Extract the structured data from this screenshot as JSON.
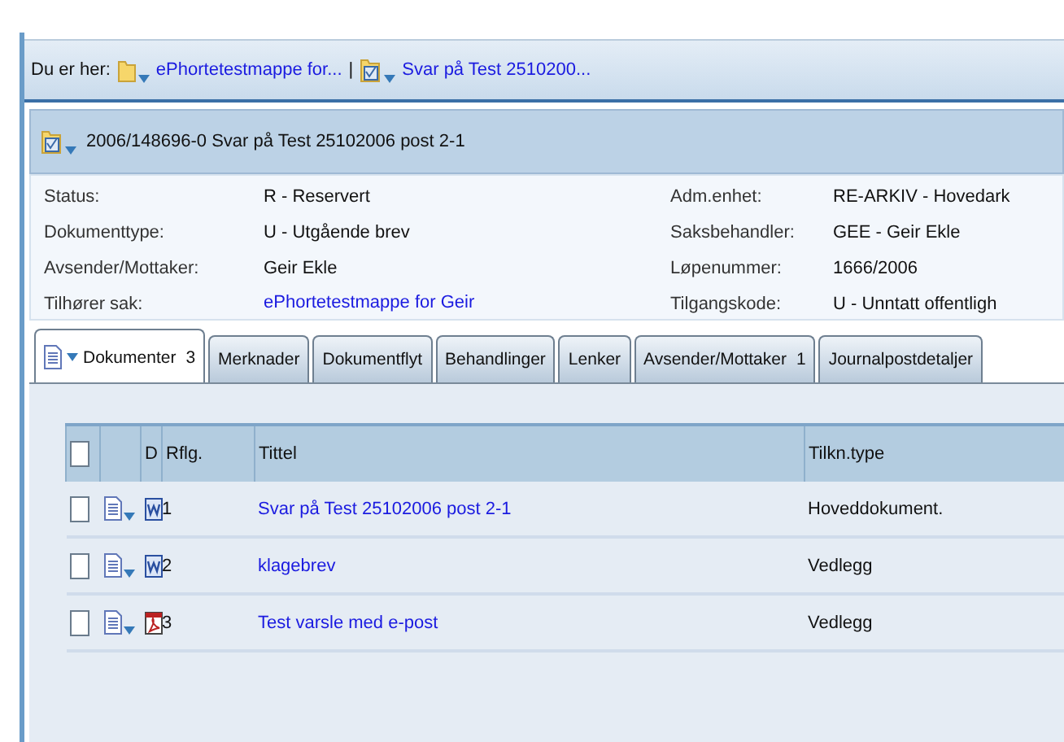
{
  "breadcrumb": {
    "label": "Du er her:",
    "items": [
      {
        "kind": "folder",
        "text": "ePhortetestmappe for..."
      },
      {
        "kind": "record",
        "text": "Svar på Test 2510200..."
      }
    ],
    "separator": "|"
  },
  "header": {
    "title": "2006/148696-0  Svar på Test 25102006 post 2-1"
  },
  "details": {
    "left": [
      {
        "label": "Status:",
        "value": "R - Reservert",
        "link": false
      },
      {
        "label": "Dokumenttype:",
        "value": "U - Utgående brev",
        "link": false
      },
      {
        "label": "Avsender/Mottaker:",
        "value": "Geir Ekle",
        "link": false
      },
      {
        "label": "Tilhører sak:",
        "value": "ePhortetestmappe for Geir",
        "link": true
      }
    ],
    "right": [
      {
        "label": "Adm.enhet:",
        "value": "RE-ARKIV - Hovedark",
        "link": false
      },
      {
        "label": "Saksbehandler:",
        "value": "GEE - Geir Ekle",
        "link": false
      },
      {
        "label": "Løpenummer:",
        "value": "1666/2006",
        "link": false
      },
      {
        "label": "Tilgangskode:",
        "value": "U - Unntatt offentligh",
        "link": false
      }
    ]
  },
  "tabs": [
    {
      "label": "Dokumenter",
      "count": "3",
      "selected": true
    },
    {
      "label": "Merknader",
      "selected": false
    },
    {
      "label": "Dokumentflyt",
      "selected": false
    },
    {
      "label": "Behandlinger",
      "selected": false
    },
    {
      "label": "Lenker",
      "selected": false
    },
    {
      "label": "Avsender/Mottaker",
      "count": "1",
      "selected": false
    },
    {
      "label": "Journalpostdetaljer",
      "selected": false
    }
  ],
  "table": {
    "select_all": {
      "checked": false
    },
    "columns": [
      "D",
      "Rflg.",
      "Tittel",
      "Tilkn.type"
    ],
    "rows": [
      {
        "checked": false,
        "kind": "word",
        "number": "1",
        "title": "Svar på Test 25102006 post 2-1",
        "type": "Hoveddokument."
      },
      {
        "checked": false,
        "kind": "word",
        "number": "2",
        "title": "klagebrev",
        "type": "Vedlegg"
      },
      {
        "checked": false,
        "kind": "pdf",
        "number": "3",
        "title": "Test varsle med e-post",
        "type": "Vedlegg"
      }
    ]
  }
}
